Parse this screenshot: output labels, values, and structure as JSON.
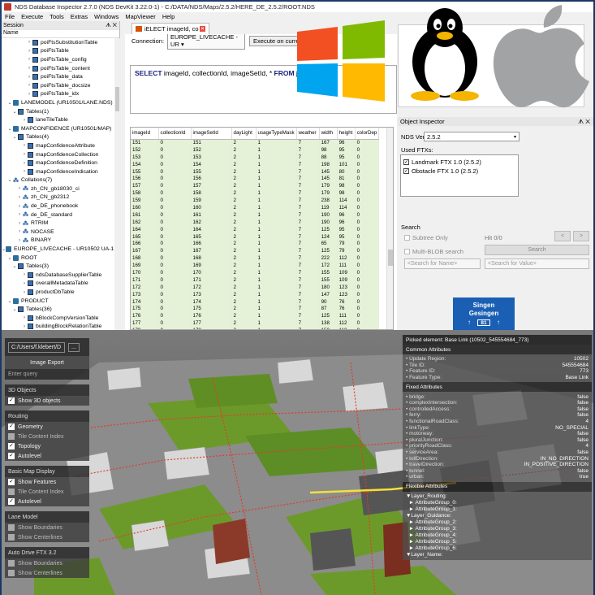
{
  "window": {
    "title": "NDS Database Inspector 2.7.0 (NDS DevKit 3.22.0-1) - C:/DATA/NDS/Maps/2.5.2/HERE_DE_2.5.2/ROOT.NDS"
  },
  "menu": [
    "File",
    "Execute",
    "Tools",
    "Extras",
    "Windows",
    "MapViewer",
    "Help"
  ],
  "session": {
    "title": "Session",
    "col": "Name",
    "tree": [
      {
        "label": "poiFtsSubstitutionTable",
        "indent": 5,
        "icon": "tbl"
      },
      {
        "label": "poiFtsTable",
        "indent": 5,
        "icon": "tbl"
      },
      {
        "label": "poiFtsTable_config",
        "indent": 5,
        "icon": "tbl"
      },
      {
        "label": "poiFtsTable_content",
        "indent": 5,
        "icon": "tbl"
      },
      {
        "label": "poiFtsTable_data",
        "indent": 5,
        "icon": "tbl"
      },
      {
        "label": "poiFtsTable_docsize",
        "indent": 5,
        "icon": "tbl"
      },
      {
        "label": "poiFtsTable_idx",
        "indent": 5,
        "icon": "tbl"
      },
      {
        "label": "LANEMODEL (UR10501/LANE.NDS)",
        "indent": 1,
        "icon": "db",
        "open": true
      },
      {
        "label": "Tables(1)",
        "indent": 2,
        "icon": "tbl",
        "open": true
      },
      {
        "label": "laneTileTable",
        "indent": 4,
        "icon": "tbl"
      },
      {
        "label": "MAPCONFIDENCE (UR10501/MAP)",
        "indent": 1,
        "icon": "db",
        "open": true
      },
      {
        "label": "Tables(4)",
        "indent": 2,
        "icon": "tbl",
        "open": true
      },
      {
        "label": "mapConfidenceAttribute",
        "indent": 4,
        "icon": "tbl"
      },
      {
        "label": "mapConfidenceCollection",
        "indent": 4,
        "icon": "tbl"
      },
      {
        "label": "mapConfidenceDefinition",
        "indent": 4,
        "icon": "tbl"
      },
      {
        "label": "mapConfidenceIndication",
        "indent": 4,
        "icon": "tbl"
      },
      {
        "label": "Collations(7)",
        "indent": 1,
        "icon": "col",
        "open": true
      },
      {
        "label": "zh_CN_gb18030_ci",
        "indent": 3,
        "icon": "col"
      },
      {
        "label": "zh_CN_gb2312",
        "indent": 3,
        "icon": "col"
      },
      {
        "label": "de_DE_phonebook",
        "indent": 3,
        "icon": "col"
      },
      {
        "label": "de_DE_standard",
        "indent": 3,
        "icon": "col"
      },
      {
        "label": "RTRIM",
        "indent": 3,
        "icon": "col"
      },
      {
        "label": "NOCASE",
        "indent": 3,
        "icon": "col"
      },
      {
        "label": "BINARY",
        "indent": 3,
        "icon": "col"
      },
      {
        "label": "EUROPE_LIVECACHE - UR10502 UA-1",
        "indent": 0,
        "icon": "db",
        "open": true
      },
      {
        "label": "ROOT",
        "indent": 1,
        "icon": "db",
        "open": true
      },
      {
        "label": "Tables(3)",
        "indent": 2,
        "icon": "tbl",
        "open": true
      },
      {
        "label": "ndsDatabaseSupplierTable",
        "indent": 4,
        "icon": "tbl"
      },
      {
        "label": "overallMetadataTable",
        "indent": 4,
        "icon": "tbl"
      },
      {
        "label": "productDbTable",
        "indent": 4,
        "icon": "tbl"
      },
      {
        "label": "PRODUCT",
        "indent": 1,
        "icon": "db",
        "open": true
      },
      {
        "label": "Tables(36)",
        "indent": 2,
        "icon": "tbl",
        "open": true
      },
      {
        "label": "bBlockCompVersionTable",
        "indent": 4,
        "icon": "tbl"
      },
      {
        "label": "buildingBlockRelationTable",
        "indent": 4,
        "icon": "tbl"
      },
      {
        "label": "buildingBlockTable",
        "indent": 4,
        "icon": "tbl"
      }
    ]
  },
  "query": {
    "tab": "iELECT imageId, co",
    "conn_label": "Connection:",
    "conn_value": "EUROPE_LIVECACHE - UR",
    "exec_label": "Execute on current",
    "sql_kw1": "SELECT",
    "sql_body": " imageId, collectionId, imageSetId, * ",
    "sql_kw2": "FROM",
    "sql_tail": " jv"
  },
  "grid": {
    "cols": [
      "imageId",
      "collectionId",
      "imageSetId",
      "dayLight",
      "usageTypeMask",
      "weather",
      "width",
      "height",
      "colorDep"
    ],
    "rows": [
      [
        "151",
        "0",
        "151",
        "2",
        "1",
        "7",
        "167",
        "96",
        "0"
      ],
      [
        "152",
        "0",
        "152",
        "2",
        "1",
        "7",
        "98",
        "95",
        "0"
      ],
      [
        "153",
        "0",
        "153",
        "2",
        "1",
        "7",
        "88",
        "95",
        "0"
      ],
      [
        "154",
        "0",
        "154",
        "2",
        "1",
        "7",
        "198",
        "101",
        "0"
      ],
      [
        "155",
        "0",
        "155",
        "2",
        "1",
        "7",
        "145",
        "80",
        "0"
      ],
      [
        "156",
        "0",
        "156",
        "2",
        "1",
        "7",
        "145",
        "81",
        "0"
      ],
      [
        "157",
        "0",
        "157",
        "2",
        "1",
        "7",
        "179",
        "98",
        "0"
      ],
      [
        "158",
        "0",
        "158",
        "2",
        "1",
        "7",
        "179",
        "98",
        "0"
      ],
      [
        "159",
        "0",
        "159",
        "2",
        "1",
        "7",
        "238",
        "114",
        "0"
      ],
      [
        "160",
        "0",
        "160",
        "2",
        "1",
        "7",
        "119",
        "114",
        "0"
      ],
      [
        "161",
        "0",
        "161",
        "2",
        "1",
        "7",
        "190",
        "96",
        "0"
      ],
      [
        "162",
        "0",
        "162",
        "2",
        "1",
        "7",
        "190",
        "96",
        "0"
      ],
      [
        "164",
        "0",
        "164",
        "2",
        "1",
        "7",
        "125",
        "95",
        "0"
      ],
      [
        "165",
        "0",
        "165",
        "2",
        "1",
        "7",
        "124",
        "95",
        "0"
      ],
      [
        "166",
        "0",
        "166",
        "2",
        "1",
        "7",
        "65",
        "79",
        "0"
      ],
      [
        "167",
        "0",
        "167",
        "2",
        "1",
        "7",
        "125",
        "79",
        "0"
      ],
      [
        "168",
        "0",
        "168",
        "2",
        "1",
        "7",
        "222",
        "112",
        "0"
      ],
      [
        "169",
        "0",
        "169",
        "2",
        "1",
        "7",
        "172",
        "111",
        "0"
      ],
      [
        "170",
        "0",
        "170",
        "2",
        "1",
        "7",
        "155",
        "109",
        "0"
      ],
      [
        "171",
        "0",
        "171",
        "2",
        "1",
        "7",
        "155",
        "109",
        "0"
      ],
      [
        "172",
        "0",
        "172",
        "2",
        "1",
        "7",
        "180",
        "123",
        "0"
      ],
      [
        "173",
        "0",
        "173",
        "2",
        "1",
        "7",
        "147",
        "123",
        "0"
      ],
      [
        "174",
        "0",
        "174",
        "2",
        "1",
        "7",
        "90",
        "76",
        "0"
      ],
      [
        "175",
        "0",
        "175",
        "2",
        "1",
        "7",
        "87",
        "76",
        "0"
      ],
      [
        "176",
        "0",
        "176",
        "2",
        "1",
        "7",
        "125",
        "111",
        "0"
      ],
      [
        "177",
        "0",
        "177",
        "2",
        "1",
        "7",
        "138",
        "112",
        "0"
      ],
      [
        "178",
        "0",
        "178",
        "2",
        "1",
        "7",
        "150",
        "110",
        "0"
      ]
    ]
  },
  "inspector": {
    "title": "Object Inspector",
    "nds_label": "NDS Version:",
    "nds_value": "2.5.2",
    "ftx_label": "Used FTXs:",
    "ftx": [
      "Landmark FTX 1.0 (2.5.2)",
      "Obstacle FTX 1.0 (2.5.2)"
    ],
    "search_label": "Search",
    "subtree": "Subtree Only",
    "hit": "Hit 0/0",
    "prev": "<",
    "next": ">",
    "multiblob": "Multi-BLOB search",
    "search_btn": "Search",
    "name_ph": "<Search for Name>",
    "value_ph": "<Search for Value>",
    "sign_line1": "Singen",
    "sign_line2": "Gesingen",
    "sign_num": "81"
  },
  "map": {
    "path": "C:/Users/f.klebert/D",
    "path_btn": "...",
    "export": "Image Export",
    "enter_query": "Enter query",
    "groups": [
      {
        "title": "3D Objects",
        "items": [
          {
            "label": "Show 3D objects",
            "on": true
          }
        ]
      },
      {
        "title": "Routing",
        "items": [
          {
            "label": "Geometry",
            "on": true
          },
          {
            "label": "Tile Content Index",
            "on": false
          },
          {
            "label": "Topology",
            "on": true
          },
          {
            "label": "Autolevel",
            "on": true
          }
        ]
      },
      {
        "title": "Basic Map Display",
        "items": [
          {
            "label": "Show Features",
            "on": true
          },
          {
            "label": "Tile Content Index",
            "on": false
          },
          {
            "label": "Autolevel",
            "on": true
          }
        ]
      },
      {
        "title": "Lane Model",
        "items": [
          {
            "label": "Show Boundaries",
            "on": false
          },
          {
            "label": "Show Centerlines",
            "on": false
          }
        ]
      },
      {
        "title": "Auto Drive FTX 3.2",
        "items": [
          {
            "label": "Show Boundaries",
            "on": false
          },
          {
            "label": "Show Centerlines",
            "on": false
          }
        ]
      }
    ],
    "picked": "Picked element: Base Link (10502_545554684_773)",
    "common_hdr": "Common Attributes",
    "common": [
      [
        "• Update Region:",
        "10502"
      ],
      [
        "• Tile ID:",
        "545554684"
      ],
      [
        "• Feature ID:",
        "773"
      ],
      [
        "• Feature Type:",
        "Base Link"
      ]
    ],
    "fixed_hdr": "Fixed Attributes",
    "fixed": [
      [
        "• bridge:",
        "false"
      ],
      [
        "• complexIntersection:",
        "false"
      ],
      [
        "• controlledAccess:",
        "false"
      ],
      [
        "• ferry:",
        "false"
      ],
      [
        "• functionalRoadClass:",
        "4"
      ],
      [
        "• linkType:",
        "NO_SPECIAL"
      ],
      [
        "• motorway:",
        "false"
      ],
      [
        "• pluralJunction:",
        "false"
      ],
      [
        "• priorityRoadClass:",
        "4"
      ],
      [
        "• serviceArea:",
        "false"
      ],
      [
        "• tollDirection:",
        "IN_NO_DIRECTION"
      ],
      [
        "• travelDirection:",
        "IN_POSITIVE_DIRECTION"
      ],
      [
        "• tunnel:",
        "false"
      ],
      [
        "• urban:",
        "true"
      ]
    ],
    "flex_hdr": "Flexible Attributes",
    "flex": [
      "▼Layer_Routing:",
      "  ► AttributeGroup_0:",
      "  ► AttributeGroup_1:",
      "▼Layer_Guidance:",
      "  ► AttributeGroup_2:",
      "  ► AttributeGroup_3:",
      "  ► AttributeGroup_4:",
      "  ► AttributeGroup_5:",
      "  ► AttributeGroup_6:",
      "▼Layer_Name:"
    ]
  }
}
